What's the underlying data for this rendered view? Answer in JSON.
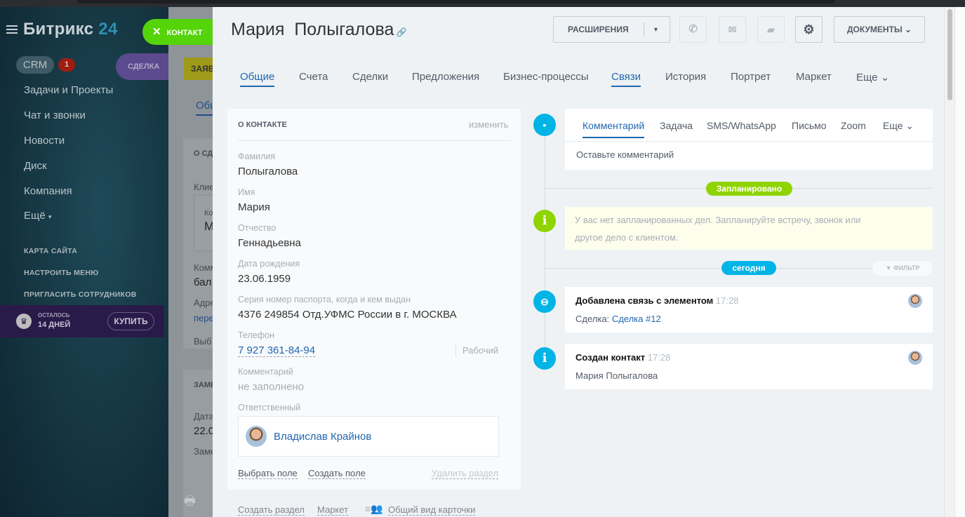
{
  "sidebar": {
    "logo_main": "Битрикс",
    "logo_num": "24",
    "crm": "CRM",
    "crm_badge": "1",
    "items": [
      "Задачи и Проекты",
      "Чат и звонки",
      "Новости",
      "Диск",
      "Компания",
      "Ещё"
    ],
    "small_links": [
      "КАРТА САЙТА",
      "НАСТРОИТЬ МЕНЮ",
      "ПРИГЛАСИТЬ СОТРУДНИКОВ"
    ],
    "trial_label": "ОСТАЛОСЬ",
    "trial_days": "14 ДНЕЙ",
    "buy": "КУПИТЬ"
  },
  "background_page": {
    "tabs": [
      "ЗАЯВ",
      "Общ"
    ],
    "texts": [
      "О СД",
      "Клие",
      "Ко",
      "М",
      "Комм",
      "бал",
      "Адре",
      "пере",
      "Выб",
      "ЗАМЕ",
      "Дата",
      "22.0",
      "Заме"
    ]
  },
  "slider_tabs": {
    "contact": "КОНТАКТ",
    "deal": "СДЕЛКА"
  },
  "header": {
    "first_name": "Мария",
    "last_name": "Полыгалова",
    "extensions": "РАСШИРЕНИЯ",
    "documents": "ДОКУМЕНТЫ"
  },
  "tabs": [
    "Общие",
    "Счета",
    "Сделки",
    "Предложения",
    "Бизнес-процессы",
    "Связи",
    "История",
    "Портрет",
    "Маркет",
    "Еще"
  ],
  "about": {
    "title": "О КОНТАКТЕ",
    "edit": "изменить",
    "fields": [
      {
        "label": "Фамилия",
        "value": "Полыгалова"
      },
      {
        "label": "Имя",
        "value": "Мария"
      },
      {
        "label": "Отчество",
        "value": "Геннадьевна"
      },
      {
        "label": "Дата рождения",
        "value": "23.06.1959"
      },
      {
        "label": "Серия номер паспорта, когда и кем выдан",
        "value": "4376 249854 Отд.УФМС России в г. МОСКВА"
      }
    ],
    "phone_label": "Телефон",
    "phone": "7 927 361-84-94",
    "phone_type": "Рабочий",
    "comment_label": "Комментарий",
    "comment": "не заполнено",
    "responsible_label": "Ответственный",
    "responsible": "Владислав Крайнов",
    "select_field": "Выбрать поле",
    "create_field": "Создать поле",
    "delete_section": "Удалить раздел"
  },
  "footer": {
    "create_section": "Создать раздел",
    "market": "Маркет",
    "common_view": "Общий вид карточки"
  },
  "timeline": {
    "tabs": [
      "Комментарий",
      "Задача",
      "SMS/WhatsApp",
      "Письмо",
      "Zoom",
      "Еще"
    ],
    "comment_placeholder": "Оставьте комментарий",
    "planned": "Запланировано",
    "planned_text_1": "У вас нет запланированных дел. Запланируйте встречу, звонок или",
    "planned_text_2": "другое дело с клиентом.",
    "today": "сегодня",
    "filter": "ФИЛЬТР",
    "events": [
      {
        "title": "Добавлена связь с элементом",
        "time": "17:28",
        "prefix": "Сделка:",
        "link": "Сделка #12"
      },
      {
        "title": "Создан контакт",
        "time": "17:28",
        "text": "Мария Полыгалова"
      }
    ]
  }
}
